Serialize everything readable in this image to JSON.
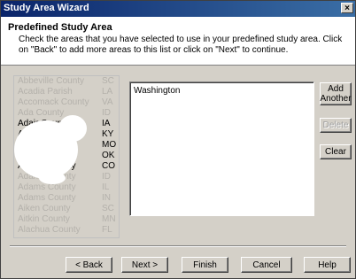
{
  "window": {
    "title": "Study Area Wizard",
    "close_glyph": "×"
  },
  "header": {
    "heading": "Predefined Study Area",
    "description": "Check the areas that you have selected to use in your predefined study area.  Click on \"Back\" to add more areas to this list or click on \"Next\" to continue."
  },
  "county_list": [
    {
      "name": "Abbeville County",
      "state": "SC"
    },
    {
      "name": "Acadia Parish",
      "state": "LA"
    },
    {
      "name": "Accomack County",
      "state": "VA"
    },
    {
      "name": "Ada County",
      "state": "ID"
    },
    {
      "name": "Adair County",
      "state": "IA"
    },
    {
      "name": "Adair County",
      "state": "KY"
    },
    {
      "name": "Adair County",
      "state": "MO"
    },
    {
      "name": "Adair County",
      "state": "OK"
    },
    {
      "name": "Adams County",
      "state": "CO"
    },
    {
      "name": "Adams County",
      "state": "ID"
    },
    {
      "name": "Adams County",
      "state": "IL"
    },
    {
      "name": "Adams County",
      "state": "IN"
    },
    {
      "name": "Aiken County",
      "state": "SC"
    },
    {
      "name": "Aitkin County",
      "state": "MN"
    },
    {
      "name": "Alachua County",
      "state": "FL"
    }
  ],
  "selected_areas": [
    "Washington"
  ],
  "side_buttons": {
    "add_another": "Add Another",
    "delete": "Delete",
    "clear": "Clear"
  },
  "footer_buttons": {
    "back": "< Back",
    "next": "Next >",
    "finish": "Finish",
    "cancel": "Cancel",
    "help": "Help"
  }
}
